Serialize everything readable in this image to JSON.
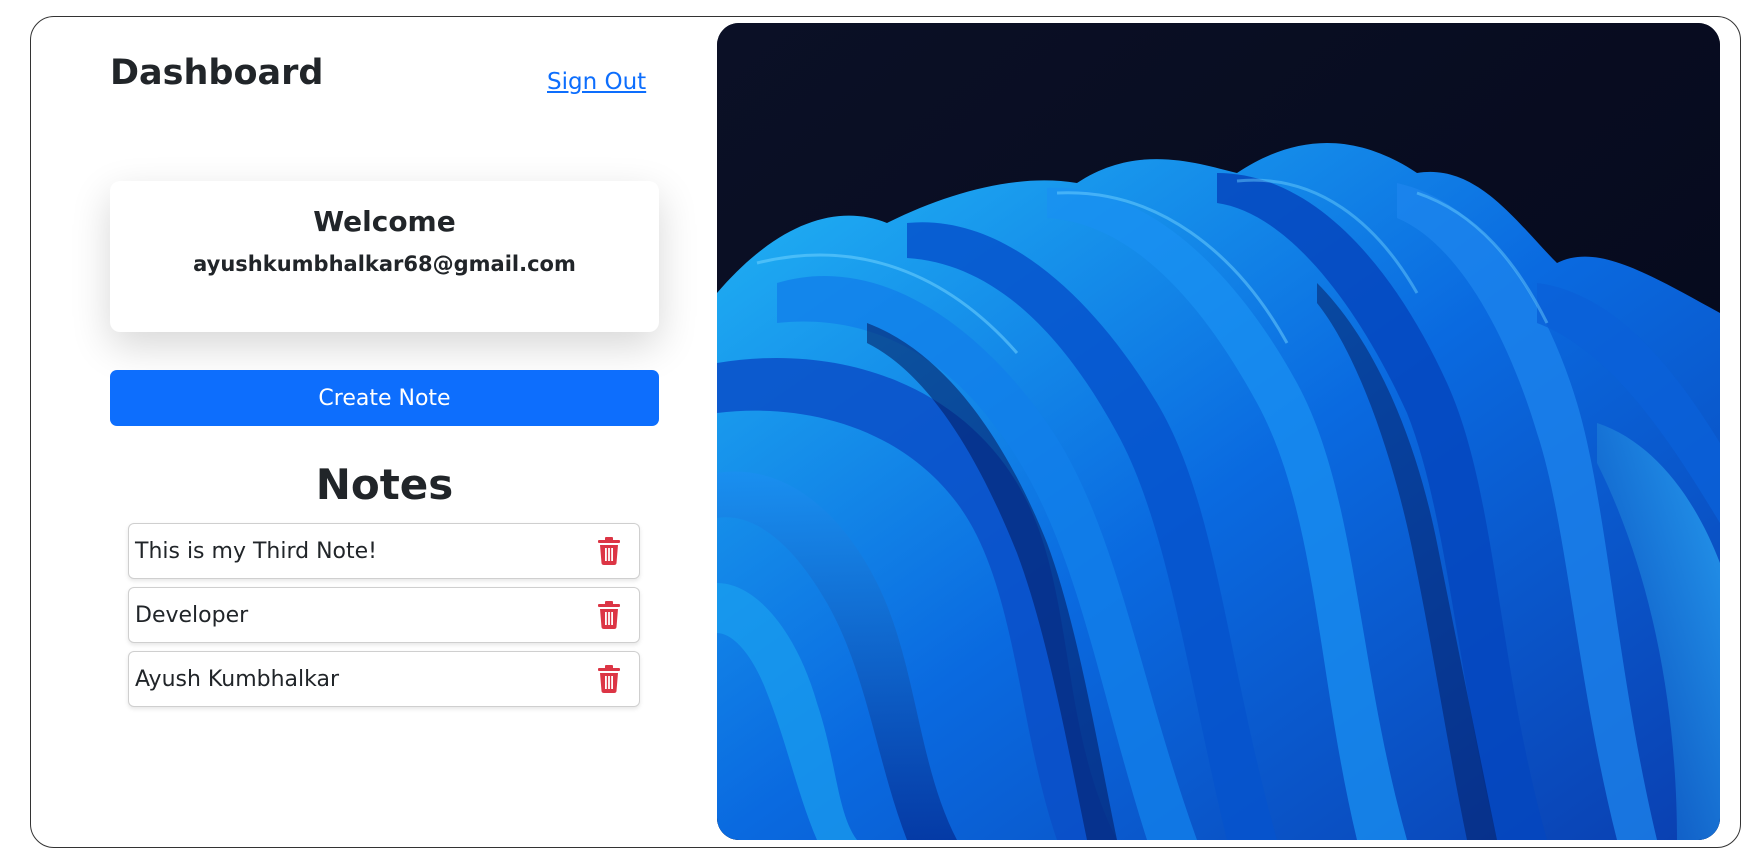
{
  "header": {
    "title": "Dashboard",
    "signout_label": "Sign Out"
  },
  "welcome": {
    "title": "Welcome",
    "email": "ayushkumbhalkar68@gmail.com"
  },
  "actions": {
    "create_note_label": "Create Note"
  },
  "notes": {
    "title": "Notes",
    "items": [
      {
        "text": "This is my Third Note!",
        "icon": "trash-icon"
      },
      {
        "text": "Developer",
        "icon": "trash-icon"
      },
      {
        "text": "Ayush Kumbhalkar",
        "icon": "trash-icon"
      }
    ]
  },
  "colors": {
    "accent": "#0d6efd",
    "danger": "#dc3545",
    "image_background": "#070c1d",
    "wave_light": "#1aa0f0",
    "wave_mid": "#0b5fd6",
    "wave_dark": "#042a8a"
  }
}
